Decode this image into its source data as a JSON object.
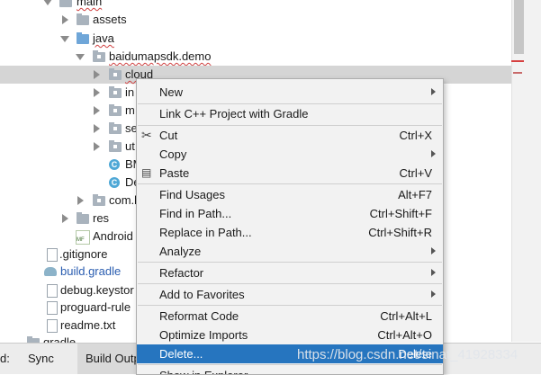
{
  "tree": {
    "main": "main",
    "assets": "assets",
    "java": "java",
    "package": "baidumapsdk.demo",
    "cloud": "cloud",
    "in": "in",
    "m": "m",
    "se": "se",
    "ut": "ut",
    "bm": "BM",
    "de": "De",
    "com": "com.b",
    "res": "res",
    "android": "Android",
    "gitignore": ".gitignore",
    "build_gradle": "build.gradle",
    "keystore": "debug.keystor",
    "proguard": "proguard-rule",
    "readme": "readme.txt",
    "gradle": "gradle"
  },
  "bottom_bar": {
    "d": "d:",
    "sync": "Sync",
    "build_output": "Build Outp"
  },
  "menu": {
    "new": "New",
    "link_cpp": "Link C++ Project with Gradle",
    "cut": "Cut",
    "cut_shortcut": "Ctrl+X",
    "copy": "Copy",
    "paste": "Paste",
    "paste_shortcut": "Ctrl+V",
    "find_usages": "Find Usages",
    "find_usages_shortcut": "Alt+F7",
    "find_in_path": "Find in Path...",
    "find_in_path_shortcut": "Ctrl+Shift+F",
    "replace_in_path": "Replace in Path...",
    "replace_in_path_shortcut": "Ctrl+Shift+R",
    "analyze": "Analyze",
    "refactor": "Refactor",
    "add_to_favorites": "Add to Favorites",
    "reformat_code": "Reformat Code",
    "reformat_code_shortcut": "Ctrl+Alt+L",
    "optimize_imports": "Optimize Imports",
    "optimize_imports_shortcut": "Ctrl+Alt+O",
    "delete": "Delete...",
    "delete_shortcut": "Delete",
    "show_in_explorer": "Show in Explorer"
  },
  "watermark": "https://blog.csdn.net/sinat_41928334",
  "colors": {
    "selection": "#2675bf",
    "tree_selection": "#d5d5d5",
    "menu_bg": "#f2f2f2"
  }
}
